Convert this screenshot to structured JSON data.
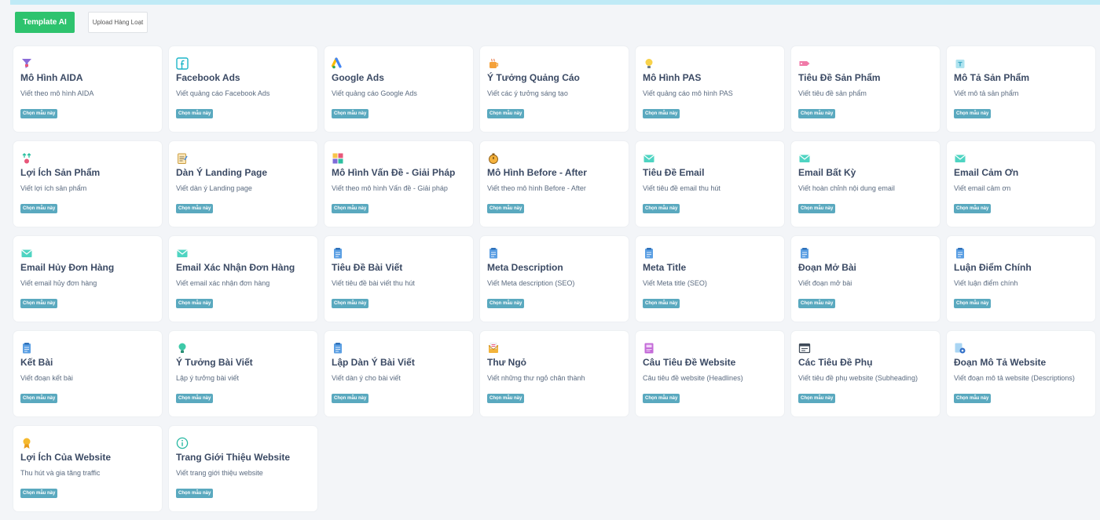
{
  "toolbar": {
    "template_ai": "Template AI",
    "upload": "Upload Hàng Loạt"
  },
  "choose_label": "Chọn mẫu này",
  "templates": [
    {
      "title": "Mô Hình AIDA",
      "desc": "Viết theo mô hình AIDA",
      "icon": "funnel-icon"
    },
    {
      "title": "Facebook Ads",
      "desc": "Viết quảng cáo Facebook Ads",
      "icon": "facebook-icon"
    },
    {
      "title": "Google Ads",
      "desc": "Viết quảng cáo Google Ads",
      "icon": "google-ads-icon"
    },
    {
      "title": "Ý Tưởng Quảng Cáo",
      "desc": "Viết các ý tưởng sáng tạo",
      "icon": "coffee-icon"
    },
    {
      "title": "Mô Hình PAS",
      "desc": "Viết quảng cáo mô hình PAS",
      "icon": "lightbulb-icon"
    },
    {
      "title": "Tiêu Đề Sản Phẩm",
      "desc": "Viết tiêu đề sản phẩm",
      "icon": "tag-icon"
    },
    {
      "title": "Mô Tả Sản Phẩm",
      "desc": "Viết mô tả sản phẩm",
      "icon": "product-box-icon"
    },
    {
      "title": "Lợi Ích Sản Phẩm",
      "desc": "Viết lợi ích sản phẩm",
      "icon": "benefit-icon"
    },
    {
      "title": "Dàn Ý Landing Page",
      "desc": "Viết dàn ý Landing page",
      "icon": "notepad-icon"
    },
    {
      "title": "Mô Hình Vấn Đề - Giải Pháp",
      "desc": "Viết theo mô hình Vấn đề - Giải pháp",
      "icon": "puzzle-icon"
    },
    {
      "title": "Mô Hình Before - After",
      "desc": "Viết theo mô hình Before - After",
      "icon": "stopwatch-icon"
    },
    {
      "title": "Tiêu Đề Email",
      "desc": "Viết tiêu đề email thu hút",
      "icon": "envelope-icon"
    },
    {
      "title": "Email Bất Kỳ",
      "desc": "Viết hoàn chỉnh nội dung email",
      "icon": "envelope-icon"
    },
    {
      "title": "Email Cảm Ơn",
      "desc": "Viết email cảm ơn",
      "icon": "envelope-icon"
    },
    {
      "title": "Email Hủy Đơn Hàng",
      "desc": "Viết email hủy đơn hàng",
      "icon": "envelope-icon"
    },
    {
      "title": "Email Xác Nhận Đơn Hàng",
      "desc": "Viết email xác nhận đơn hàng",
      "icon": "envelope-icon"
    },
    {
      "title": "Tiêu Đề Bài Viết",
      "desc": "Viết tiêu đề bài viết thu hút",
      "icon": "document-icon"
    },
    {
      "title": "Meta Description",
      "desc": "Viết Meta description (SEO)",
      "icon": "document-icon"
    },
    {
      "title": "Meta Title",
      "desc": "Viết Meta title (SEO)",
      "icon": "document-icon"
    },
    {
      "title": "Đoạn Mở Bài",
      "desc": "Viết đoạn mở bài",
      "icon": "document-icon"
    },
    {
      "title": "Luận Điểm Chính",
      "desc": "Viết luận điểm chính",
      "icon": "document-icon"
    },
    {
      "title": "Kết Bài",
      "desc": "Viết đoạn kết bài",
      "icon": "document-icon"
    },
    {
      "title": "Ý Tưởng Bài Viết",
      "desc": "Lập ý tưởng bài viết",
      "icon": "idea-bulb-icon"
    },
    {
      "title": "Lập Dàn Ý Bài Viết",
      "desc": "Viết dàn ý cho bài viết",
      "icon": "document-icon"
    },
    {
      "title": "Thư Ngỏ",
      "desc": "Viết những thư ngỏ chân thành",
      "icon": "letter-icon"
    },
    {
      "title": "Câu Tiêu Đề Website",
      "desc": "Câu tiêu đề website (Headlines)",
      "icon": "web-page-icon"
    },
    {
      "title": "Các Tiêu Đề Phụ",
      "desc": "Viết tiêu đề phụ website (Subheading)",
      "icon": "browser-window-icon"
    },
    {
      "title": "Đoạn Mô Tả Website",
      "desc": "Viết đoạn mô tả website (Descriptions)",
      "icon": "settings-doc-icon"
    },
    {
      "title": "Lợi Ích Của Website",
      "desc": "Thu hút và gia tăng traffic",
      "icon": "award-icon"
    },
    {
      "title": "Trang Giới Thiệu Website",
      "desc": "Viết trang giới thiệu website",
      "icon": "info-icon"
    }
  ]
}
